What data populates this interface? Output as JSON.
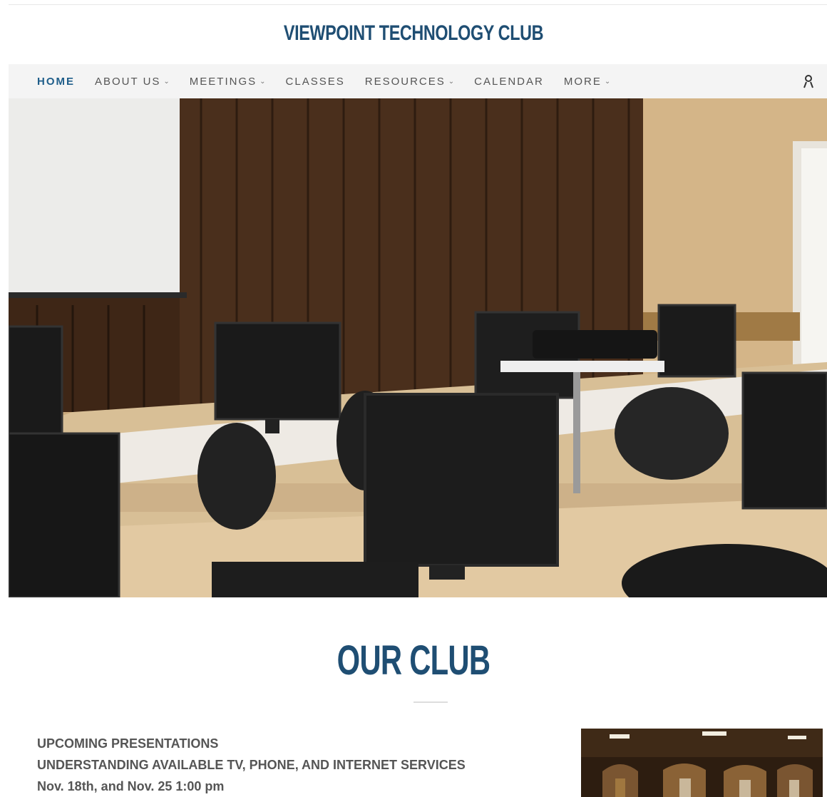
{
  "header": {
    "site_title": "VIEWPOINT TECHNOLOGY CLUB"
  },
  "nav": {
    "items": [
      {
        "label": "HOME",
        "has_dropdown": false,
        "active": true
      },
      {
        "label": "ABOUT US",
        "has_dropdown": true
      },
      {
        "label": "MEETINGS",
        "has_dropdown": true
      },
      {
        "label": "CLASSES",
        "has_dropdown": false
      },
      {
        "label": "RESOURCES",
        "has_dropdown": true
      },
      {
        "label": "CALENDAR",
        "has_dropdown": false
      },
      {
        "label": "MORE",
        "has_dropdown": true
      }
    ],
    "account_icon": "account-icon"
  },
  "hero": {
    "image": "computer-lab-photo"
  },
  "main": {
    "section_title": "OUR CLUB",
    "upcoming_heading": "UPCOMING PRESENTATIONS",
    "presentation_title": "UNDERSTANDING AVAILABLE TV, PHONE, AND INTERNET SERVICES",
    "presentation_dates": "Nov. 18th, and Nov. 25 1:00 pm"
  },
  "colors": {
    "brand": "#1f4e73",
    "nav_active": "#1f5e8a",
    "nav_bg": "#f4f4f4",
    "text": "#555555"
  }
}
